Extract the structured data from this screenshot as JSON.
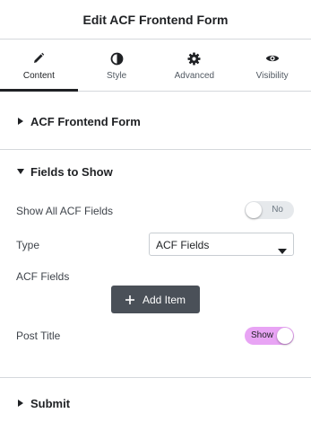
{
  "header": {
    "title": "Edit ACF Frontend Form"
  },
  "tabs": [
    {
      "label": "Content",
      "icon": "pencil-icon",
      "active": true
    },
    {
      "label": "Style",
      "icon": "half-circle-icon",
      "active": false
    },
    {
      "label": "Advanced",
      "icon": "gear-icon",
      "active": false
    },
    {
      "label": "Visibility",
      "icon": "eye-icon",
      "active": false
    }
  ],
  "sections": [
    {
      "title": "ACF Frontend Form",
      "expanded": false
    },
    {
      "title": "Fields to Show",
      "expanded": true
    },
    {
      "title": "Submit",
      "expanded": false
    }
  ],
  "fields": {
    "show_all": {
      "label": "Show All ACF Fields",
      "toggle_text": "No",
      "on": false
    },
    "type": {
      "label": "Type",
      "value": "ACF Fields"
    },
    "acf_fields": {
      "label": "ACF Fields",
      "button": "Add Item"
    },
    "post_title": {
      "label": "Post Title",
      "toggle_text": "Show",
      "on": true
    }
  },
  "colors": {
    "toggle_on": "#e8a4f4",
    "toggle_off": "#e6e9ec",
    "button_bg": "#4a5058",
    "text": "#1f2124"
  }
}
